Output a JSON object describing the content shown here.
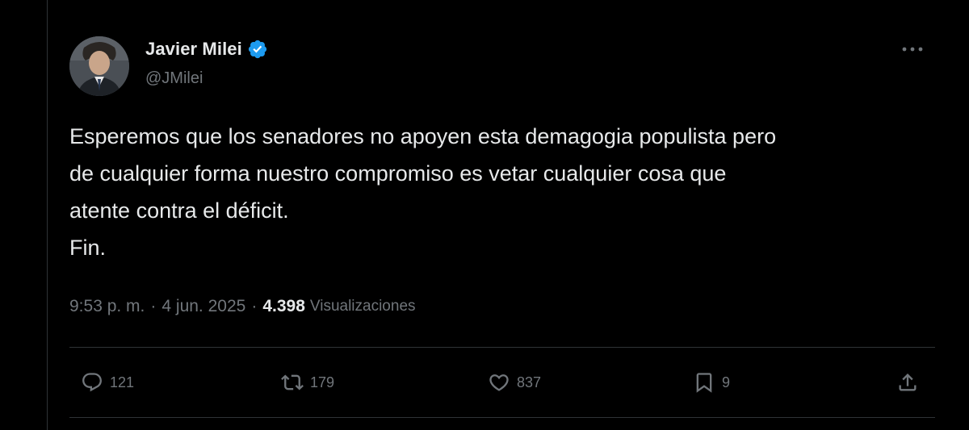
{
  "author": {
    "display_name": "Javier Milei",
    "handle": "@JMilei",
    "verified": true
  },
  "tweet": {
    "text": "Esperemos que los senadores no apoyen esta demagogia populista pero\nde cualquier forma nuestro compromiso es vetar cualquier cosa que\natente contra el déficit.\nFin.",
    "time": "9:53 p. m.",
    "separator": "·",
    "date": "4 jun. 2025",
    "views_count": "4.398",
    "views_label": "Visualizaciones"
  },
  "actions": {
    "replies": "121",
    "retweets": "179",
    "likes": "837",
    "bookmarks": "9"
  },
  "colors": {
    "background": "#000000",
    "text_primary": "#e7e9ea",
    "text_secondary": "#71767b",
    "divider": "#2f3336",
    "verified_badge": "#1d9bf0"
  },
  "icons": {
    "more": "more-icon",
    "verified": "verified-badge-icon",
    "reply": "reply-icon",
    "retweet": "retweet-icon",
    "like": "heart-icon",
    "bookmark": "bookmark-icon",
    "share": "share-icon"
  }
}
